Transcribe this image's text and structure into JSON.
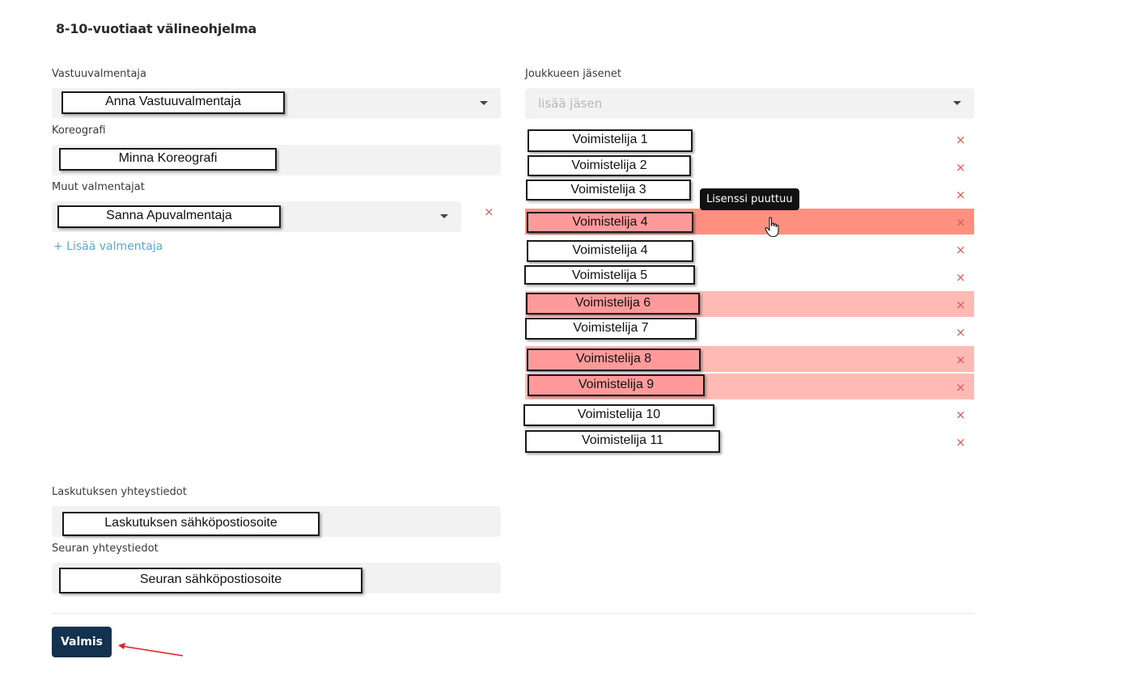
{
  "page": {
    "title": "8-10-vuotiaat välineohjelma"
  },
  "left": {
    "head_coach": {
      "label": "Vastuuvalmentaja",
      "value": "Anna Vastuuvalmentaja"
    },
    "choreographer": {
      "label": "Koreografi",
      "value": "Minna Koreografi"
    },
    "other_coaches": {
      "label": "Muut valmentajat",
      "value": "Sanna Apuvalmentaja",
      "add_link": "+ Lisää valmentaja"
    },
    "billing": {
      "label": "Laskutuksen yhteystiedot",
      "value": "Laskutuksen sähköpostiosoite"
    },
    "club": {
      "label": "Seuran yhteystiedot",
      "value": "Seuran sähköpostiosoite"
    }
  },
  "right": {
    "members_label": "Joukkueen jäsenet",
    "add_member_placeholder": "lisää jäsen",
    "members": [
      {
        "name": "Voimistelija 1",
        "status": "ok"
      },
      {
        "name": "Voimistelija 2",
        "status": "ok"
      },
      {
        "name": "Voimistelija 3",
        "status": "ok"
      },
      {
        "name": "Voimistelija 4",
        "status": "hover-missing"
      },
      {
        "name": "Voimistelija 4",
        "status": "ok"
      },
      {
        "name": "Voimistelija 5",
        "status": "ok"
      },
      {
        "name": "Voimistelija 6",
        "status": "missing"
      },
      {
        "name": "Voimistelija 7",
        "status": "ok"
      },
      {
        "name": "Voimistelija 8",
        "status": "missing"
      },
      {
        "name": "Voimistelija 9",
        "status": "missing"
      },
      {
        "name": "Voimistelija 10",
        "status": "ok"
      },
      {
        "name": "Voimistelija 11",
        "status": "ok"
      }
    ],
    "remove_glyph": "×",
    "tooltip": "Lisenssi puuttuu"
  },
  "footer": {
    "done_button": "Valmis"
  },
  "colors": {
    "primary": "#13324f",
    "link": "#5aa9cf",
    "remove": "#e05555",
    "missing_hover": "#ff9080",
    "missing": "#ffbab5"
  }
}
